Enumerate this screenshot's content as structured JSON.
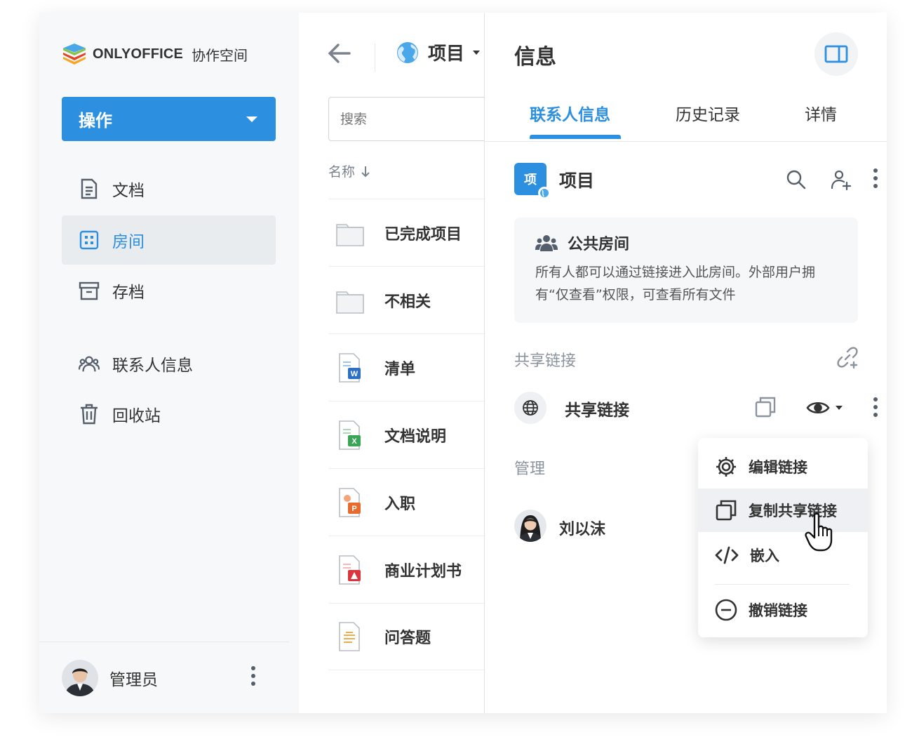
{
  "logo": {
    "brand": "ONLYOFFICE",
    "product": "协作空间"
  },
  "sidebar": {
    "action_label": "操作",
    "items": [
      {
        "label": "文档",
        "icon": "document-icon"
      },
      {
        "label": "房间",
        "icon": "rooms-icon"
      },
      {
        "label": "存档",
        "icon": "archive-icon"
      },
      {
        "label": "联系人信息",
        "icon": "contacts-icon"
      },
      {
        "label": "回收站",
        "icon": "trash-icon"
      }
    ],
    "active_item": "房间",
    "user_name": "管理员"
  },
  "middle": {
    "room_title": "项目",
    "search_placeholder": "搜索",
    "sort_label": "名称",
    "files": [
      {
        "name": "已完成项目",
        "type": "folder"
      },
      {
        "name": "不相关",
        "type": "folder"
      },
      {
        "name": "清单",
        "type": "docx"
      },
      {
        "name": "文档说明",
        "type": "xlsx"
      },
      {
        "name": "入职",
        "type": "pptx"
      },
      {
        "name": "商业计划书",
        "type": "pdf"
      },
      {
        "name": "问答题",
        "type": "txt"
      }
    ]
  },
  "info": {
    "title": "信息",
    "tabs": [
      "联系人信息",
      "历史记录",
      "详情"
    ],
    "active_tab": "联系人信息",
    "room_badge": "项",
    "room_name": "项目",
    "public_room": {
      "title": "公共房间",
      "description": "所有人都可以通过链接进入此房间。外部用户拥有“仅查看”权限，可查看所有文件"
    },
    "share_section_label": "共享链接",
    "share_link_name": "共享链接",
    "managers_label": "管理",
    "manager_name": "刘以沫",
    "context_menu": {
      "items": [
        {
          "label": "编辑链接",
          "icon": "gear-icon"
        },
        {
          "label": "复制共享链接",
          "icon": "copy-icon"
        },
        {
          "label": "嵌入",
          "icon": "code-icon"
        },
        {
          "label": "撤销链接",
          "icon": "minus-circle-icon"
        }
      ],
      "hovered": "复制共享链接"
    }
  },
  "colors": {
    "accent": "#2d8fe0",
    "sidebar_bg": "#f7f8f9",
    "text": "#333333"
  }
}
